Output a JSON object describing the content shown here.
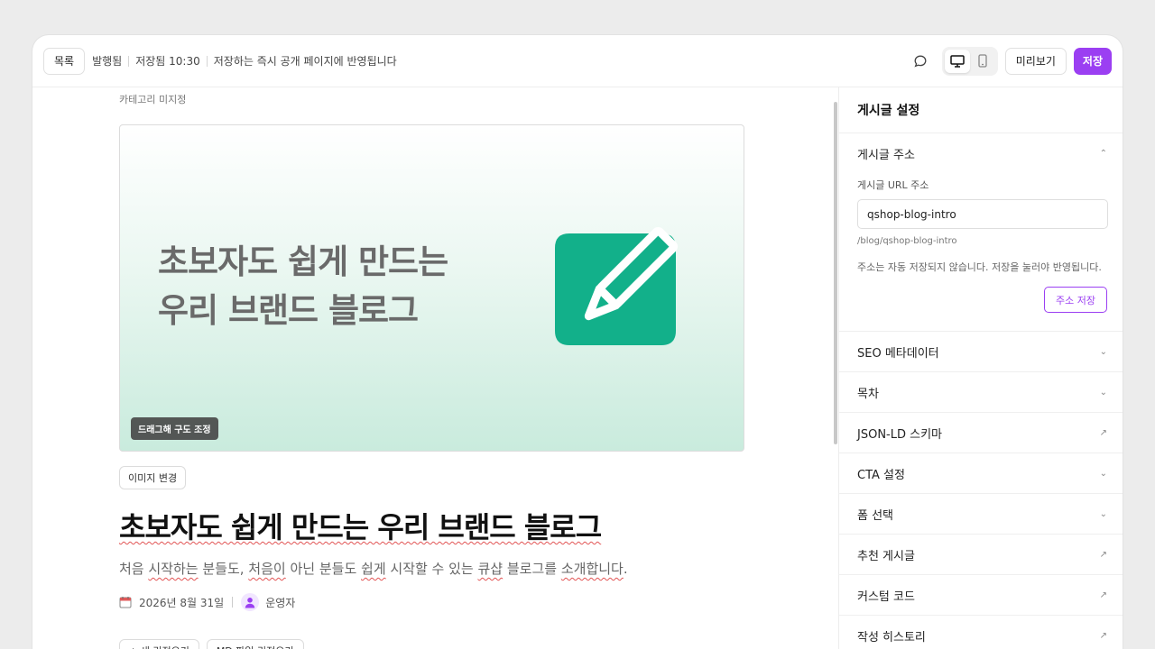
{
  "topbar": {
    "list_label": "목록",
    "status_published": "발행됨",
    "status_saved": "저장됨 10:30",
    "status_note": "저장하는 즉시 공개 페이지에 반영됩니다",
    "preview_label": "미리보기",
    "save_label": "저장"
  },
  "editor": {
    "category": "카테고리 미지정",
    "cover": {
      "title_line1": "초보자도 쉽게 만드는",
      "title_line2": "우리 브랜드 블로그",
      "drag_hint": "드래그해 구도 조정"
    },
    "change_image_label": "이미지 변경",
    "title": "초보자도 쉽게 만드는 우리 브랜드 블로그",
    "subtitle_parts": [
      "처음 ",
      "시작하는",
      " 분들도, ",
      "처음이",
      " 아닌 분들도 ",
      "쉽게",
      " 시작할 수 있는 ",
      "큐샵",
      " 블로그를 ",
      "소개합니다",
      "."
    ],
    "date": "2026년 8월 31일",
    "author": "운영자",
    "bottom_buttons": [
      "+ 새 리전오기",
      "MD 파일 리전오기"
    ]
  },
  "panel": {
    "title": "게시글 설정",
    "address": {
      "label": "게시글 주소",
      "url_label": "게시글 URL 주소",
      "url_value": "qshop-blog-intro",
      "path": "/blog/qshop-blog-intro",
      "note": "주소는 자동 저장되지 않습니다. 저장을 눌러야 반영됩니다.",
      "save_label": "주소 저장"
    },
    "sections": [
      {
        "label": "SEO 메타데이터",
        "icon": "chevron-down-icon"
      },
      {
        "label": "목차",
        "icon": "chevron-down-icon"
      },
      {
        "label": "JSON-LD 스키마",
        "icon": "external-arrow-icon"
      },
      {
        "label": "CTA 설정",
        "icon": "chevron-down-icon"
      },
      {
        "label": "폼 선택",
        "icon": "chevron-down-icon"
      },
      {
        "label": "추천 게시글",
        "icon": "external-arrow-icon"
      },
      {
        "label": "커스텀 코드",
        "icon": "external-arrow-icon"
      },
      {
        "label": "작성 히스토리",
        "icon": "external-arrow-icon"
      }
    ]
  },
  "colors": {
    "accent": "#9b3ff2",
    "logo_green": "#12b08a"
  }
}
